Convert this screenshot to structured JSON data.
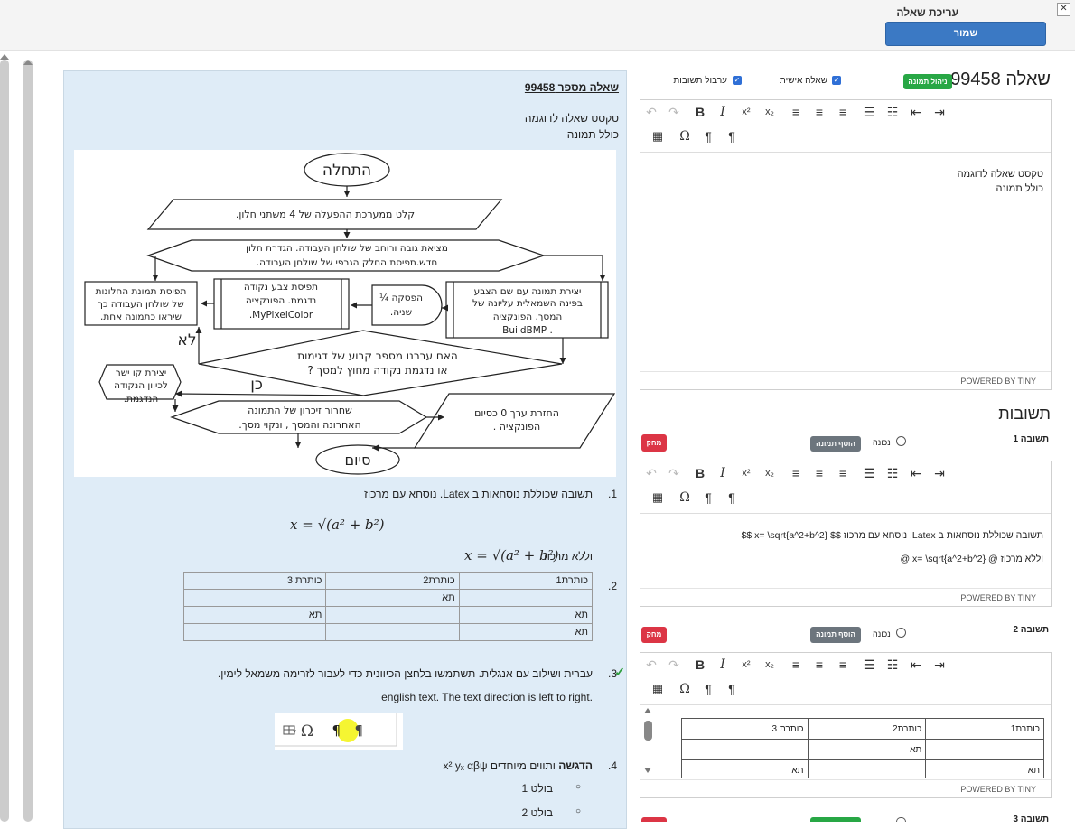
{
  "header": {
    "title": "עריכת שאלה",
    "save_label": "שמור",
    "close_label": "✕"
  },
  "preview": {
    "title": "שאלה מספר 99458",
    "text_line1": "טקסט שאלה לדוגמה",
    "text_line2": "כולל תמונה",
    "flowchart": {
      "start": "התחלה",
      "step1": "קלט ממערכת ההפעלה של 4 משתני חלון.",
      "step2a": "מציאת גובה ורוחב של שולחן העבודה. הגדרת חלון",
      "step2b": "חדש.תפיסת החלק הגרפי של שולחן העבודה.",
      "box_left1": "תפיסת תמונת החלונות",
      "box_left2": "של שולחן העבודה כך",
      "box_left3": "שיראו כתמונה אחת.",
      "box_mid1": "תפיסת צבע נקודה",
      "box_mid2": "נדגמת. הפונקציה",
      "box_mid3": "MyPixelColor.",
      "pause1": "הפסקה ¼",
      "pause2": "שניה.",
      "box_right1": "יצירת תמונה עם שם הצבע",
      "box_right2": "בפינה השמאלית עליונה של",
      "box_right3": "המסך. הפונקציה",
      "box_right4": ". BuildBMP",
      "decision1": "האם עברנו מספר קבוע של דגימות",
      "decision2": "או נדגמת נקודה מחוץ למסך ?",
      "no_label": "לא",
      "yes_label": "כן",
      "line1": "יצירת קו ישר",
      "line2": "לכיוון הנקודה",
      "line3": "הנדגמת.",
      "free1": "שחרור זיכרון של התמונה",
      "free2": "האחרונה והמסך , ונקוי מסך.",
      "ret1": "החזרת ערך 0 כסיום",
      "ret2": "הפונקציה .",
      "end": "סיום"
    },
    "answers": {
      "a1_num": "1.",
      "a1_text": "תשובה שכוללת נוסחאות ב Latex. נוסחא עם מרכוז",
      "a1_formula": "x = √(a² + b²)",
      "a1_inline_label": "וללא מרכוז",
      "a1_inline_formula": "x = √(a² + b²)",
      "a2_num": "2.",
      "table": [
        [
          "כותרת1",
          "כותרת2",
          "כותרת 3"
        ],
        [
          "",
          "תא",
          ""
        ],
        [
          "תא",
          "",
          "תא"
        ],
        [
          "תא",
          "",
          ""
        ]
      ],
      "a3_num": "3.",
      "a3_check": "✓",
      "a3_text": "עברית ושילוב עם אנגלית. תשתמשו בלחצן הכיוונית כדי לעבור לזרימה משמאל לימין.",
      "a3_english": "english text. The text direction is left to right.",
      "a4_num": "4.",
      "a4_bold": "הדגשה",
      "a4_text": " ותווים מיוחדים",
      "a4_special": "x² yₓ αβψ",
      "bullet1": "בולט 1",
      "bullet2": "בולט 2"
    }
  },
  "editor": {
    "question_title": "שאלה 99458",
    "manage_image_label": "ניהול תמונה",
    "personal_label": "שאלה אישית",
    "shuffle_label": "ערבול תשובות",
    "content_line1": "טקסט שאלה לדוגמה",
    "content_line2": "כולל תמונה",
    "powered_by": "POWERED BY TINY",
    "answers_heading": "תשובות",
    "answer1": {
      "label": "תשובה 1",
      "correct_label": "נכונה",
      "add_image_label": "הוסף תמונה",
      "delete_label": "מחק",
      "line1": "תשובה שכוללת נוסחאות ב Latex. נוסחא עם מרכוז $$ x= \\sqrt{a^2+b^2} $$",
      "line2": "וללא מרכוז @ x= \\sqrt{a^2+b^2} @"
    },
    "answer2": {
      "label": "תשובה 2",
      "correct_label": "נכונה",
      "add_image_label": "הוסף תמונה",
      "delete_label": "מחק",
      "table": [
        [
          "כותרת1",
          "כותרת2",
          "כותרת 3"
        ],
        [
          "",
          "תא",
          ""
        ],
        [
          "תא",
          "",
          "תא"
        ]
      ]
    },
    "answer3_label": "תשובה 3"
  },
  "colors": {
    "primary": "#3b79c4",
    "success": "#28a745",
    "danger": "#dc3545",
    "secondary": "#6c757d",
    "preview_bg": "#dfecf7"
  }
}
